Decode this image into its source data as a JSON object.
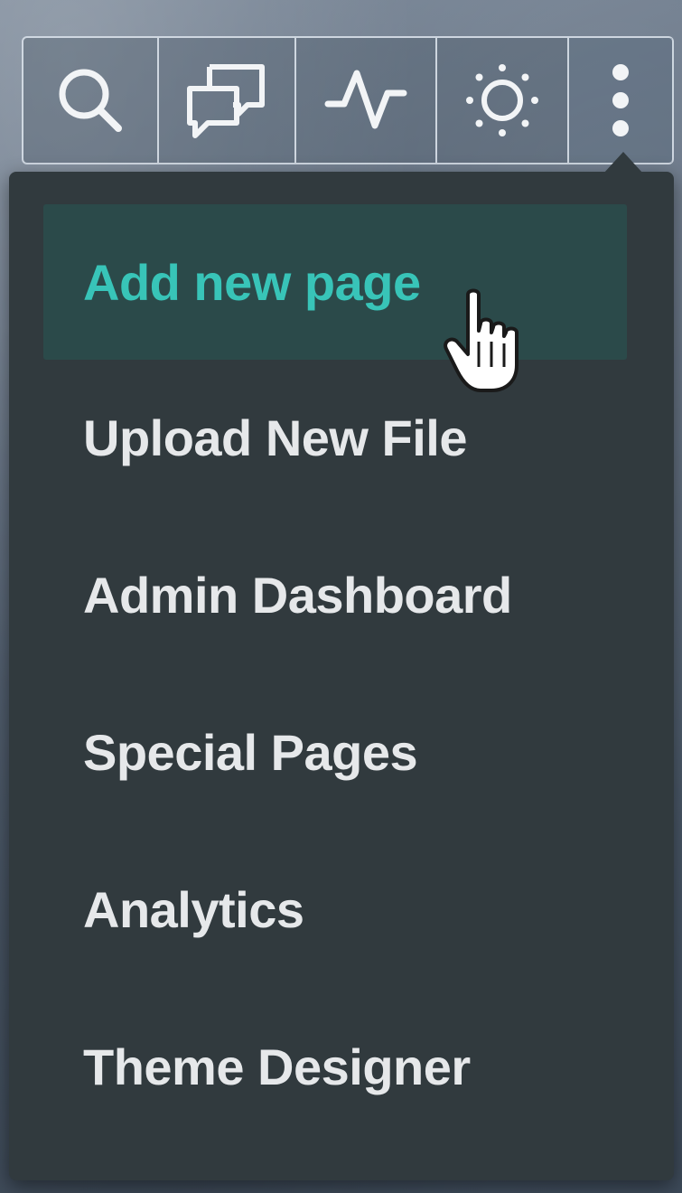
{
  "toolbar": {
    "buttons": [
      {
        "icon": "search-icon",
        "label": ""
      },
      {
        "icon": "chat-icon",
        "label": ""
      },
      {
        "icon": "activity-icon",
        "label": ""
      },
      {
        "icon": "sun-icon",
        "label": ""
      },
      {
        "icon": "more-vertical-icon",
        "label": ""
      }
    ]
  },
  "menu": {
    "items": [
      {
        "label": "Add new page"
      },
      {
        "label": "Upload New File"
      },
      {
        "label": "Admin Dashboard"
      },
      {
        "label": "Special Pages"
      },
      {
        "label": "Analytics"
      },
      {
        "label": "Theme Designer"
      }
    ]
  },
  "colors": {
    "menu_background": "#313a3e",
    "hover_background": "#2b4a4a",
    "hover_text": "#38c4b8",
    "menu_text": "#e6e8ea",
    "toolbar_border": "#e1e8f0"
  }
}
